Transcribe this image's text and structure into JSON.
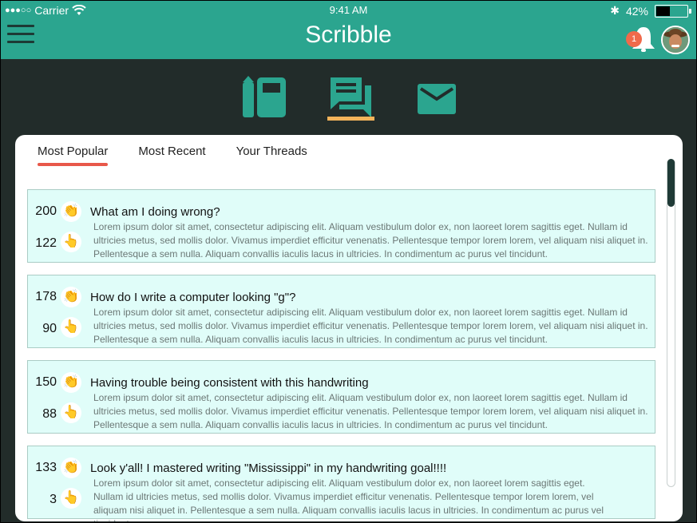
{
  "status": {
    "carrier": "Carrier",
    "time": "9:41 AM",
    "battery": "42%",
    "battery_level": 0.42
  },
  "header": {
    "title": "Scribble",
    "notification_count": "1"
  },
  "modes": [
    {
      "icon": "notebook-icon"
    },
    {
      "icon": "chat-threads-icon",
      "active": true
    },
    {
      "icon": "mail-icon"
    }
  ],
  "colors": {
    "header": "#2ba58f",
    "background": "#222c2a",
    "card": "#e0fdf9",
    "tab_underline": "#e8584a",
    "mode_underline": "#f3b35a"
  },
  "tabs": [
    {
      "label": "Most Popular",
      "active": true
    },
    {
      "label": "Most Recent"
    },
    {
      "label": "Your Threads"
    }
  ],
  "threads": [
    {
      "claps": "200",
      "points": "122",
      "title": "What am I doing wrong?",
      "body": "Lorem ipsum dolor sit amet, consectetur adipiscing elit. Aliquam vestibulum dolor ex, non laoreet lorem sagittis eget. Nullam id ultricies metus, sed mollis dolor. Vivamus imperdiet efficitur venenatis. Pellentesque tempor lorem lorem, vel aliquam nisi aliquet in. Pellentesque a sem nulla. Aliquam convallis iaculis lacus in ultricies. In condimentum ac purus vel tincidunt."
    },
    {
      "claps": "178",
      "points": "90",
      "title": "How do I write a computer looking \"g\"?",
      "body": "Lorem ipsum dolor sit amet, consectetur adipiscing elit. Aliquam vestibulum dolor ex, non laoreet lorem sagittis eget. Nullam id ultricies metus, sed mollis dolor. Vivamus imperdiet efficitur venenatis. Pellentesque tempor lorem lorem, vel aliquam nisi aliquet in. Pellentesque a sem nulla. Aliquam convallis iaculis lacus in ultricies. In condimentum ac purus vel tincidunt."
    },
    {
      "claps": "150",
      "points": "88",
      "title": "Having trouble being consistent with this handwriting",
      "body": "Lorem ipsum dolor sit amet, consectetur adipiscing elit. Aliquam vestibulum dolor ex, non laoreet lorem sagittis eget. Nullam id ultricies metus, sed mollis dolor. Vivamus imperdiet efficitur venenatis. Pellentesque tempor lorem lorem, vel aliquam nisi aliquet in. Pellentesque a sem nulla. Aliquam convallis iaculis lacus in ultricies. In condimentum ac purus vel tincidunt."
    },
    {
      "claps": "133",
      "points": "3",
      "title": "Look y'all! I mastered writing \"Mississippi\" in my handwriting goal!!!!",
      "body": "Lorem ipsum dolor sit amet, consectetur adipiscing elit. Aliquam vestibulum dolor ex, non laoreet lorem sagittis eget. Nullam id ultricies metus, sed mollis dolor. Vivamus imperdiet efficitur venenatis. Pellentesque tempor lorem lorem, vel aliquam nisi aliquet in. Pellentesque a sem nulla. Aliquam convallis iaculis lacus in ultricies. In condimentum ac purus vel tincidunt."
    }
  ]
}
